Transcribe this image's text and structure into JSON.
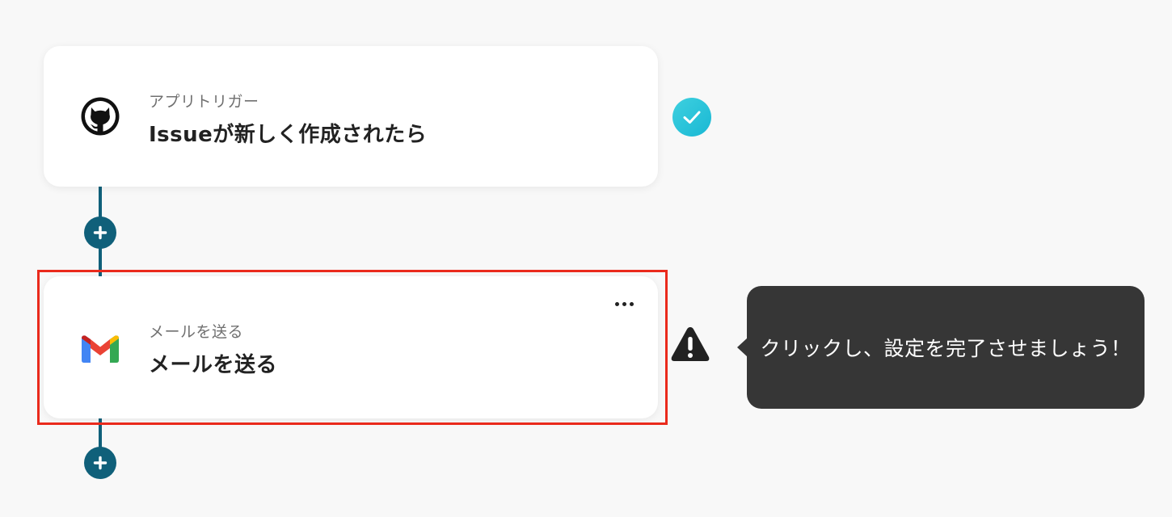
{
  "flow": {
    "steps": [
      {
        "app_icon": "github-icon",
        "subtitle": "アプリトリガー",
        "title": "Issueが新しく作成されたら",
        "status": "complete",
        "status_icon": "check-icon"
      },
      {
        "app_icon": "gmail-icon",
        "subtitle": "メールを送る",
        "title": "メールを送る",
        "status": "incomplete",
        "status_icon": "warning-icon",
        "menu_icon": "more-horizontal-icon"
      }
    ],
    "add_button_icon": "plus-icon"
  },
  "tooltip": {
    "text": "クリックし、設定を完了させましょう！"
  },
  "colors": {
    "connector": "#10607a",
    "check": "#19b8d4",
    "highlight": "#ea2a1c",
    "tooltip_bg": "#363636",
    "background": "#f8f8f8"
  }
}
